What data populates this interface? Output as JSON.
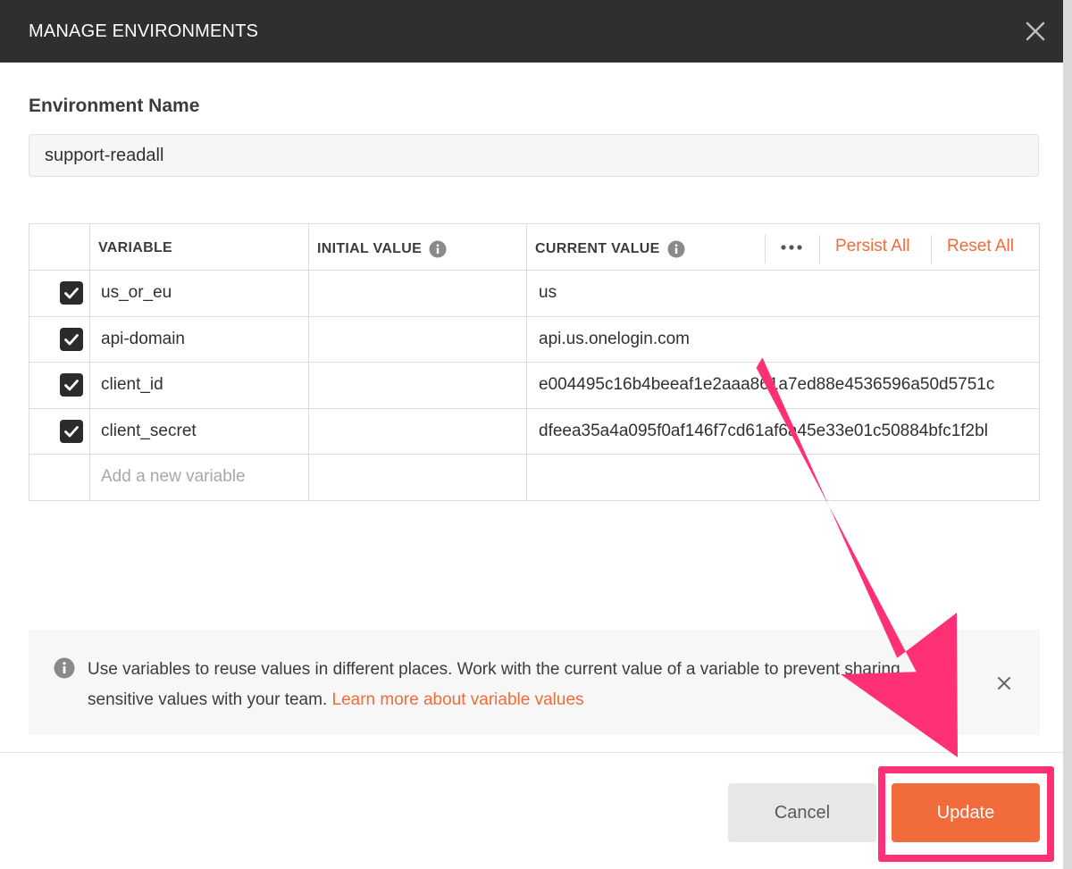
{
  "dialog": {
    "title": "MANAGE ENVIRONMENTS"
  },
  "environment": {
    "label": "Environment Name",
    "value": "support-readall"
  },
  "table": {
    "columns": {
      "variable": "VARIABLE",
      "initial_value": "INITIAL VALUE",
      "current_value": "CURRENT VALUE"
    },
    "persist_all": "Persist All",
    "reset_all": "Reset All",
    "rows": [
      {
        "enabled": true,
        "variable": "us_or_eu",
        "initial_value": "",
        "current_value": "us"
      },
      {
        "enabled": true,
        "variable": "api-domain",
        "initial_value": "",
        "current_value": "api.us.onelogin.com"
      },
      {
        "enabled": true,
        "variable": "client_id",
        "initial_value": "",
        "current_value": "e004495c16b4beeaf1e2aaa861a7ed88e4536596a50d5751c"
      },
      {
        "enabled": true,
        "variable": "client_secret",
        "initial_value": "",
        "current_value": "dfeea35a4a095f0af146f7cd61af6a45e33e01c50884bfc1f2bl"
      }
    ],
    "new_variable_placeholder": "Add a new variable"
  },
  "info_banner": {
    "text": "Use variables to reuse values in different places. Work with the current value of a variable to prevent sharing sensitive values with your team. ",
    "link": "Learn more about variable values"
  },
  "footer": {
    "cancel_label": "Cancel",
    "update_label": "Update"
  },
  "colors": {
    "accent": "#f26b3a",
    "header_bg": "#2f2f2f",
    "annotation": "#ff3076"
  }
}
